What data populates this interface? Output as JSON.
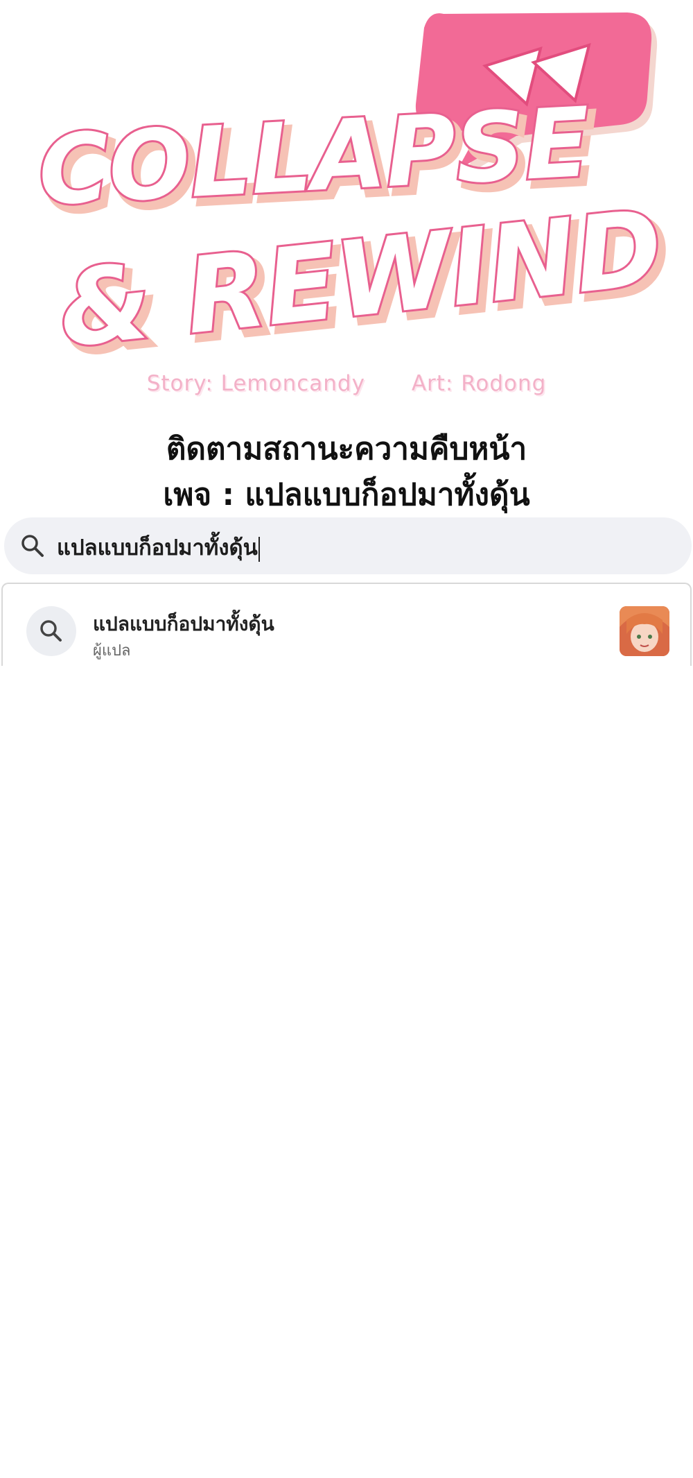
{
  "logo": {
    "line1": "COLLAPSE",
    "line2": "& REWIND"
  },
  "credits": {
    "story": "Story: Lemoncandy",
    "art": "Art: Rodong"
  },
  "notice": {
    "line1": "ติดตามสถานะความคืบหน้า",
    "line2": "เพจ : แปลแบบก็อปมาทั้งดุ้น"
  },
  "search": {
    "query": "แปลแบบก็อปมาทั้งดุ้น",
    "icon": "search-icon"
  },
  "suggestions": [
    {
      "title": "แปลแบบก็อปมาทั้งดุ้น",
      "subtitle": "ผู้แปล",
      "icon": "search-icon",
      "thumb": "avatar"
    }
  ],
  "colors": {
    "logo_fill": "#ffffff",
    "logo_outline": "#e8608f",
    "logo_shadow": "#f6c2b5",
    "bubble": "#f26a96",
    "credits": "#f3b1c8",
    "search_bg": "#f0f1f5"
  }
}
